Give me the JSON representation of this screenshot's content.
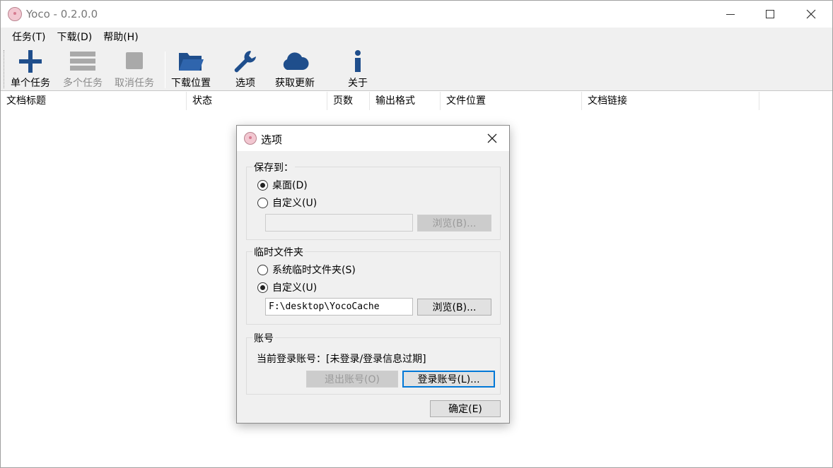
{
  "window": {
    "title": "Yoco - 0.2.0.0"
  },
  "menu": [
    {
      "label": "任务(T)"
    },
    {
      "label": "下载(D)"
    },
    {
      "label": "帮助(H)"
    }
  ],
  "toolbar": {
    "single_task": "单个任务",
    "multi_task": "多个任务",
    "cancel_task": "取消任务",
    "download_location": "下载位置",
    "options": "选项",
    "get_updates": "获取更新",
    "about": "关于"
  },
  "columns": [
    "文档标题",
    "状态",
    "页数",
    "输出格式",
    "文件位置",
    "文档链接"
  ],
  "dialog": {
    "title": "选项",
    "save_to": {
      "label": "保存到：",
      "desktop": "桌面(D)",
      "custom": "自定义(U)",
      "selected": "desktop",
      "path": "",
      "browse": "浏览(B)..."
    },
    "temp": {
      "label": "临时文件夹",
      "system": "系统临时文件夹(S)",
      "custom": "自定义(U)",
      "selected": "custom",
      "path": "F:\\desktop\\YocoCache",
      "browse": "浏览(B)..."
    },
    "account": {
      "label": "账号",
      "status": "当前登录账号：[未登录/登录信息过期]",
      "logout": "退出账号(O)",
      "login": "登录账号(L)..."
    },
    "ok": "确定(E)"
  },
  "colors": {
    "icon_blue": "#1f4e8c",
    "icon_gray": "#a9a9a9"
  }
}
